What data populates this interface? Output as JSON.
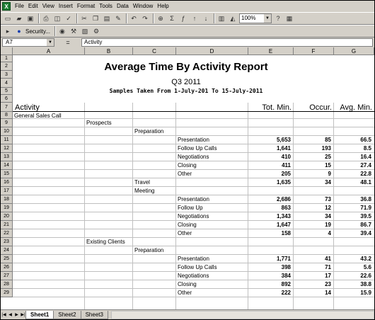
{
  "menu": [
    "File",
    "Edit",
    "View",
    "Insert",
    "Format",
    "Tools",
    "Data",
    "Window",
    "Help"
  ],
  "toolbar": {
    "zoom": "100%",
    "security": "Security..."
  },
  "formula_bar": {
    "cell_ref": "A7",
    "fx": "=",
    "content": "Activity"
  },
  "columns": [
    "A",
    "B",
    "C",
    "D",
    "E",
    "F",
    "G"
  ],
  "rows": [
    "1",
    "2",
    "3",
    "4",
    "5",
    "6",
    "7",
    "8",
    "9",
    "10",
    "11",
    "12",
    "13",
    "14",
    "15",
    "16",
    "17",
    "18",
    "19",
    "20",
    "21",
    "22",
    "23",
    "24",
    "25",
    "26",
    "27",
    "28",
    "29"
  ],
  "report": {
    "title": "Average Time By Activity Report",
    "quarter": "Q3 2011",
    "samples": "Samples Taken From 1-July-201 To 15-July-2011",
    "headers": {
      "activity": "Activity",
      "tot_min": "Tot. Min.",
      "occur": "Occur.",
      "avg_min": "Avg. Min."
    }
  },
  "cells": [
    {
      "row": 8,
      "col": "A",
      "text": "General Sales Call"
    },
    {
      "row": 9,
      "col": "B",
      "text": "Prospects"
    },
    {
      "row": 10,
      "col": "C",
      "text": "Preparation"
    },
    {
      "row": 11,
      "col": "D",
      "text": "Presentation",
      "e": "5,653",
      "f": "85",
      "g": "66.5"
    },
    {
      "row": 12,
      "col": "D",
      "text": "Follow Up Calls",
      "e": "1,641",
      "f": "193",
      "g": "8.5"
    },
    {
      "row": 13,
      "col": "D",
      "text": "Negotiations",
      "e": "410",
      "f": "25",
      "g": "16.4"
    },
    {
      "row": 14,
      "col": "D",
      "text": "Closing",
      "e": "411",
      "f": "15",
      "g": "27.4"
    },
    {
      "row": 15,
      "col": "D",
      "text": "Other",
      "e": "205",
      "f": "9",
      "g": "22.8"
    },
    {
      "row": 16,
      "col": "C",
      "text": "Travel",
      "e": "1,635",
      "f": "34",
      "g": "48.1"
    },
    {
      "row": 17,
      "col": "C",
      "text": "Meeting"
    },
    {
      "row": 18,
      "col": "D",
      "text": "Presentation",
      "e": "2,686",
      "f": "73",
      "g": "36.8"
    },
    {
      "row": 19,
      "col": "D",
      "text": "Follow Up",
      "e": "863",
      "f": "12",
      "g": "71.9"
    },
    {
      "row": 20,
      "col": "D",
      "text": "Negotiations",
      "e": "1,343",
      "f": "34",
      "g": "39.5"
    },
    {
      "row": 21,
      "col": "D",
      "text": "Closing",
      "e": "1,647",
      "f": "19",
      "g": "86.7"
    },
    {
      "row": 22,
      "col": "D",
      "text": "Other",
      "e": "158",
      "f": "4",
      "g": "39.4"
    },
    {
      "row": 23,
      "col": "B",
      "text": "Existing Clients"
    },
    {
      "row": 24,
      "col": "C",
      "text": "Preparation"
    },
    {
      "row": 25,
      "col": "D",
      "text": "Presentation",
      "e": "1,771",
      "f": "41",
      "g": "43.2"
    },
    {
      "row": 26,
      "col": "D",
      "text": "Follow Up Calls",
      "e": "398",
      "f": "71",
      "g": "5.6"
    },
    {
      "row": 27,
      "col": "D",
      "text": "Negotiations",
      "e": "384",
      "f": "17",
      "g": "22.6"
    },
    {
      "row": 28,
      "col": "D",
      "text": "Closing",
      "e": "892",
      "g": "38.8",
      "f": "23"
    },
    {
      "row": 29,
      "col": "D",
      "text": "Other",
      "e": "222",
      "f": "14",
      "g": "15.9"
    }
  ],
  "sheets": [
    "Sheet1",
    "Sheet2",
    "Sheet3"
  ]
}
